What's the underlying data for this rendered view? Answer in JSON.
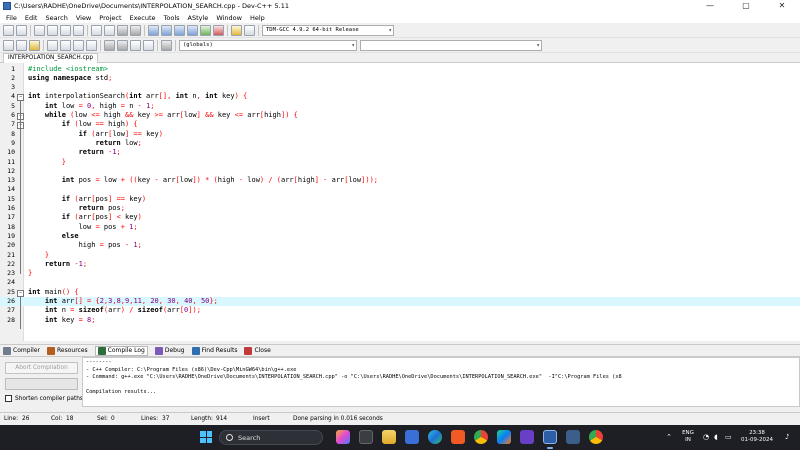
{
  "window": {
    "title": "C:\\Users\\RADHE\\OneDrive\\Documents\\INTERPOLATION_SEARCH.cpp - Dev-C++ 5.11",
    "controls": [
      "—",
      "▢",
      "✕"
    ]
  },
  "menu": [
    "File",
    "Edit",
    "Search",
    "View",
    "Project",
    "Execute",
    "Tools",
    "AStyle",
    "Window",
    "Help"
  ],
  "toolbar": {
    "compiler_combo": "TDM-GCC 4.9.2 64-bit Release",
    "globals_combo": "(globals)"
  },
  "file_tab": "INTERPOLATION_SEARCH.cpp",
  "editor": {
    "current_line": 26,
    "lines": [
      {
        "n": "1",
        "text": "#include <iostream>"
      },
      {
        "n": "2",
        "text": "using namespace std;"
      },
      {
        "n": "3",
        "text": ""
      },
      {
        "n": "4",
        "text": "int interpolationSearch(int arr[], int n, int key) {"
      },
      {
        "n": "5",
        "text": "    int low = 0, high = n - 1;"
      },
      {
        "n": "6",
        "text": "    while (low <= high && key >= arr[low] && key <= arr[high]) {"
      },
      {
        "n": "7",
        "text": "        if (low == high) {"
      },
      {
        "n": "8",
        "text": "            if (arr[low] == key)"
      },
      {
        "n": "9",
        "text": "                return low;"
      },
      {
        "n": "10",
        "text": "            return -1;"
      },
      {
        "n": "11",
        "text": "        }"
      },
      {
        "n": "12",
        "text": ""
      },
      {
        "n": "13",
        "text": "        int pos = low + ((key - arr[low]) * (high - low) / (arr[high] - arr[low]));"
      },
      {
        "n": "14",
        "text": ""
      },
      {
        "n": "15",
        "text": "        if (arr[pos] == key)"
      },
      {
        "n": "16",
        "text": "            return pos;"
      },
      {
        "n": "17",
        "text": "        if (arr[pos] < key)"
      },
      {
        "n": "18",
        "text": "            low = pos + 1;"
      },
      {
        "n": "19",
        "text": "        else"
      },
      {
        "n": "20",
        "text": "            high = pos - 1;"
      },
      {
        "n": "21",
        "text": "    }"
      },
      {
        "n": "22",
        "text": "    return -1;"
      },
      {
        "n": "23",
        "text": "}"
      },
      {
        "n": "24",
        "text": ""
      },
      {
        "n": "25",
        "text": "int main() {"
      },
      {
        "n": "26",
        "text": "    int arr[] = {2,3,8,9,11, 20, 30, 40, 50};"
      },
      {
        "n": "27",
        "text": "    int n = sizeof(arr) / sizeof(arr[0]);"
      },
      {
        "n": "28",
        "text": "    int key = 8;"
      }
    ]
  },
  "bottom_tabs": [
    {
      "label": "Compiler",
      "icon": "compiler-icon"
    },
    {
      "label": "Resources",
      "icon": "resources-icon"
    },
    {
      "label": "Compile Log",
      "icon": "compile-log-icon"
    },
    {
      "label": "Debug",
      "icon": "debug-icon"
    },
    {
      "label": "Find Results",
      "icon": "find-results-icon"
    },
    {
      "label": "Close",
      "icon": "close-icon"
    }
  ],
  "log": {
    "abort_label": "Abort Compilation",
    "progress": 0,
    "shorten_label": "Shorten compiler paths",
    "lines": [
      "--------",
      "- C++ Compiler: C:\\Program Files (x86)\\Dev-Cpp\\MinGW64\\bin\\g++.exe",
      "- Command: g++.exe \"C:\\Users\\RADHE\\OneDrive\\Documents\\INTERPOLATION_SEARCH.cpp\" -o \"C:\\Users\\RADHE\\OneDrive\\Documents\\INTERPOLATION_SEARCH.exe\"  -I\"C:\\Program Files (x8",
      "",
      "Compilation results..."
    ]
  },
  "status": {
    "line_label": "Line:",
    "line_value": "26",
    "col_label": "Col:",
    "col_value": "18",
    "sel_label": "Sel:",
    "sel_value": "0",
    "lines_label": "Lines:",
    "lines_value": "37",
    "length_label": "Length:",
    "length_value": "914",
    "mode": "Insert",
    "message": "Done parsing in 0.016 seconds"
  },
  "taskbar": {
    "search_label": "Search",
    "lang_top": "ENG",
    "lang_bottom": "IN",
    "time": "23:38",
    "date": "01-09-2024"
  }
}
